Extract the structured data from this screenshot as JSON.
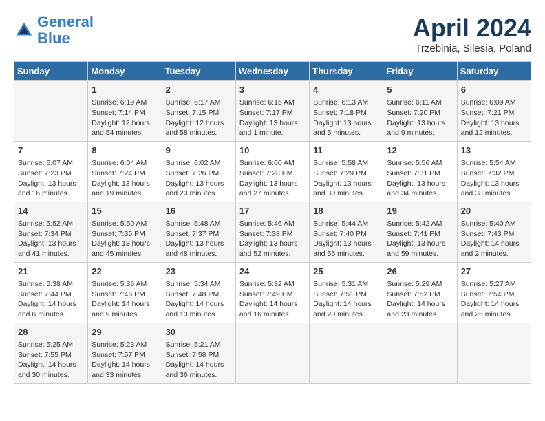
{
  "header": {
    "logo_line1": "General",
    "logo_line2": "Blue",
    "month_year": "April 2024",
    "location": "Trzebinia, Silesia, Poland"
  },
  "weekdays": [
    "Sunday",
    "Monday",
    "Tuesday",
    "Wednesday",
    "Thursday",
    "Friday",
    "Saturday"
  ],
  "weeks": [
    [
      {
        "day": "",
        "content": ""
      },
      {
        "day": "1",
        "content": "Sunrise: 6:19 AM\nSunset: 7:14 PM\nDaylight: 12 hours\nand 54 minutes."
      },
      {
        "day": "2",
        "content": "Sunrise: 6:17 AM\nSunset: 7:15 PM\nDaylight: 12 hours\nand 58 minutes."
      },
      {
        "day": "3",
        "content": "Sunrise: 6:15 AM\nSunset: 7:17 PM\nDaylight: 13 hours\nand 1 minute."
      },
      {
        "day": "4",
        "content": "Sunrise: 6:13 AM\nSunset: 7:18 PM\nDaylight: 13 hours\nand 5 minutes."
      },
      {
        "day": "5",
        "content": "Sunrise: 6:11 AM\nSunset: 7:20 PM\nDaylight: 13 hours\nand 9 minutes."
      },
      {
        "day": "6",
        "content": "Sunrise: 6:09 AM\nSunset: 7:21 PM\nDaylight: 13 hours\nand 12 minutes."
      }
    ],
    [
      {
        "day": "7",
        "content": "Sunrise: 6:07 AM\nSunset: 7:23 PM\nDaylight: 13 hours\nand 16 minutes."
      },
      {
        "day": "8",
        "content": "Sunrise: 6:04 AM\nSunset: 7:24 PM\nDaylight: 13 hours\nand 19 minutes."
      },
      {
        "day": "9",
        "content": "Sunrise: 6:02 AM\nSunset: 7:26 PM\nDaylight: 13 hours\nand 23 minutes."
      },
      {
        "day": "10",
        "content": "Sunrise: 6:00 AM\nSunset: 7:28 PM\nDaylight: 13 hours\nand 27 minutes."
      },
      {
        "day": "11",
        "content": "Sunrise: 5:58 AM\nSunset: 7:29 PM\nDaylight: 13 hours\nand 30 minutes."
      },
      {
        "day": "12",
        "content": "Sunrise: 5:56 AM\nSunset: 7:31 PM\nDaylight: 13 hours\nand 34 minutes."
      },
      {
        "day": "13",
        "content": "Sunrise: 5:54 AM\nSunset: 7:32 PM\nDaylight: 13 hours\nand 38 minutes."
      }
    ],
    [
      {
        "day": "14",
        "content": "Sunrise: 5:52 AM\nSunset: 7:34 PM\nDaylight: 13 hours\nand 41 minutes."
      },
      {
        "day": "15",
        "content": "Sunrise: 5:50 AM\nSunset: 7:35 PM\nDaylight: 13 hours\nand 45 minutes."
      },
      {
        "day": "16",
        "content": "Sunrise: 5:48 AM\nSunset: 7:37 PM\nDaylight: 13 hours\nand 48 minutes."
      },
      {
        "day": "17",
        "content": "Sunrise: 5:46 AM\nSunset: 7:38 PM\nDaylight: 13 hours\nand 52 minutes."
      },
      {
        "day": "18",
        "content": "Sunrise: 5:44 AM\nSunset: 7:40 PM\nDaylight: 13 hours\nand 55 minutes."
      },
      {
        "day": "19",
        "content": "Sunrise: 5:42 AM\nSunset: 7:41 PM\nDaylight: 13 hours\nand 59 minutes."
      },
      {
        "day": "20",
        "content": "Sunrise: 5:40 AM\nSunset: 7:43 PM\nDaylight: 14 hours\nand 2 minutes."
      }
    ],
    [
      {
        "day": "21",
        "content": "Sunrise: 5:38 AM\nSunset: 7:44 PM\nDaylight: 14 hours\nand 6 minutes."
      },
      {
        "day": "22",
        "content": "Sunrise: 5:36 AM\nSunset: 7:46 PM\nDaylight: 14 hours\nand 9 minutes."
      },
      {
        "day": "23",
        "content": "Sunrise: 5:34 AM\nSunset: 7:48 PM\nDaylight: 14 hours\nand 13 minutes."
      },
      {
        "day": "24",
        "content": "Sunrise: 5:32 AM\nSunset: 7:49 PM\nDaylight: 14 hours\nand 16 minutes."
      },
      {
        "day": "25",
        "content": "Sunrise: 5:31 AM\nSunset: 7:51 PM\nDaylight: 14 hours\nand 20 minutes."
      },
      {
        "day": "26",
        "content": "Sunrise: 5:29 AM\nSunset: 7:52 PM\nDaylight: 14 hours\nand 23 minutes."
      },
      {
        "day": "27",
        "content": "Sunrise: 5:27 AM\nSunset: 7:54 PM\nDaylight: 14 hours\nand 26 minutes."
      }
    ],
    [
      {
        "day": "28",
        "content": "Sunrise: 5:25 AM\nSunset: 7:55 PM\nDaylight: 14 hours\nand 30 minutes."
      },
      {
        "day": "29",
        "content": "Sunrise: 5:23 AM\nSunset: 7:57 PM\nDaylight: 14 hours\nand 33 minutes."
      },
      {
        "day": "30",
        "content": "Sunrise: 5:21 AM\nSunset: 7:58 PM\nDaylight: 14 hours\nand 36 minutes."
      },
      {
        "day": "",
        "content": ""
      },
      {
        "day": "",
        "content": ""
      },
      {
        "day": "",
        "content": ""
      },
      {
        "day": "",
        "content": ""
      }
    ]
  ]
}
